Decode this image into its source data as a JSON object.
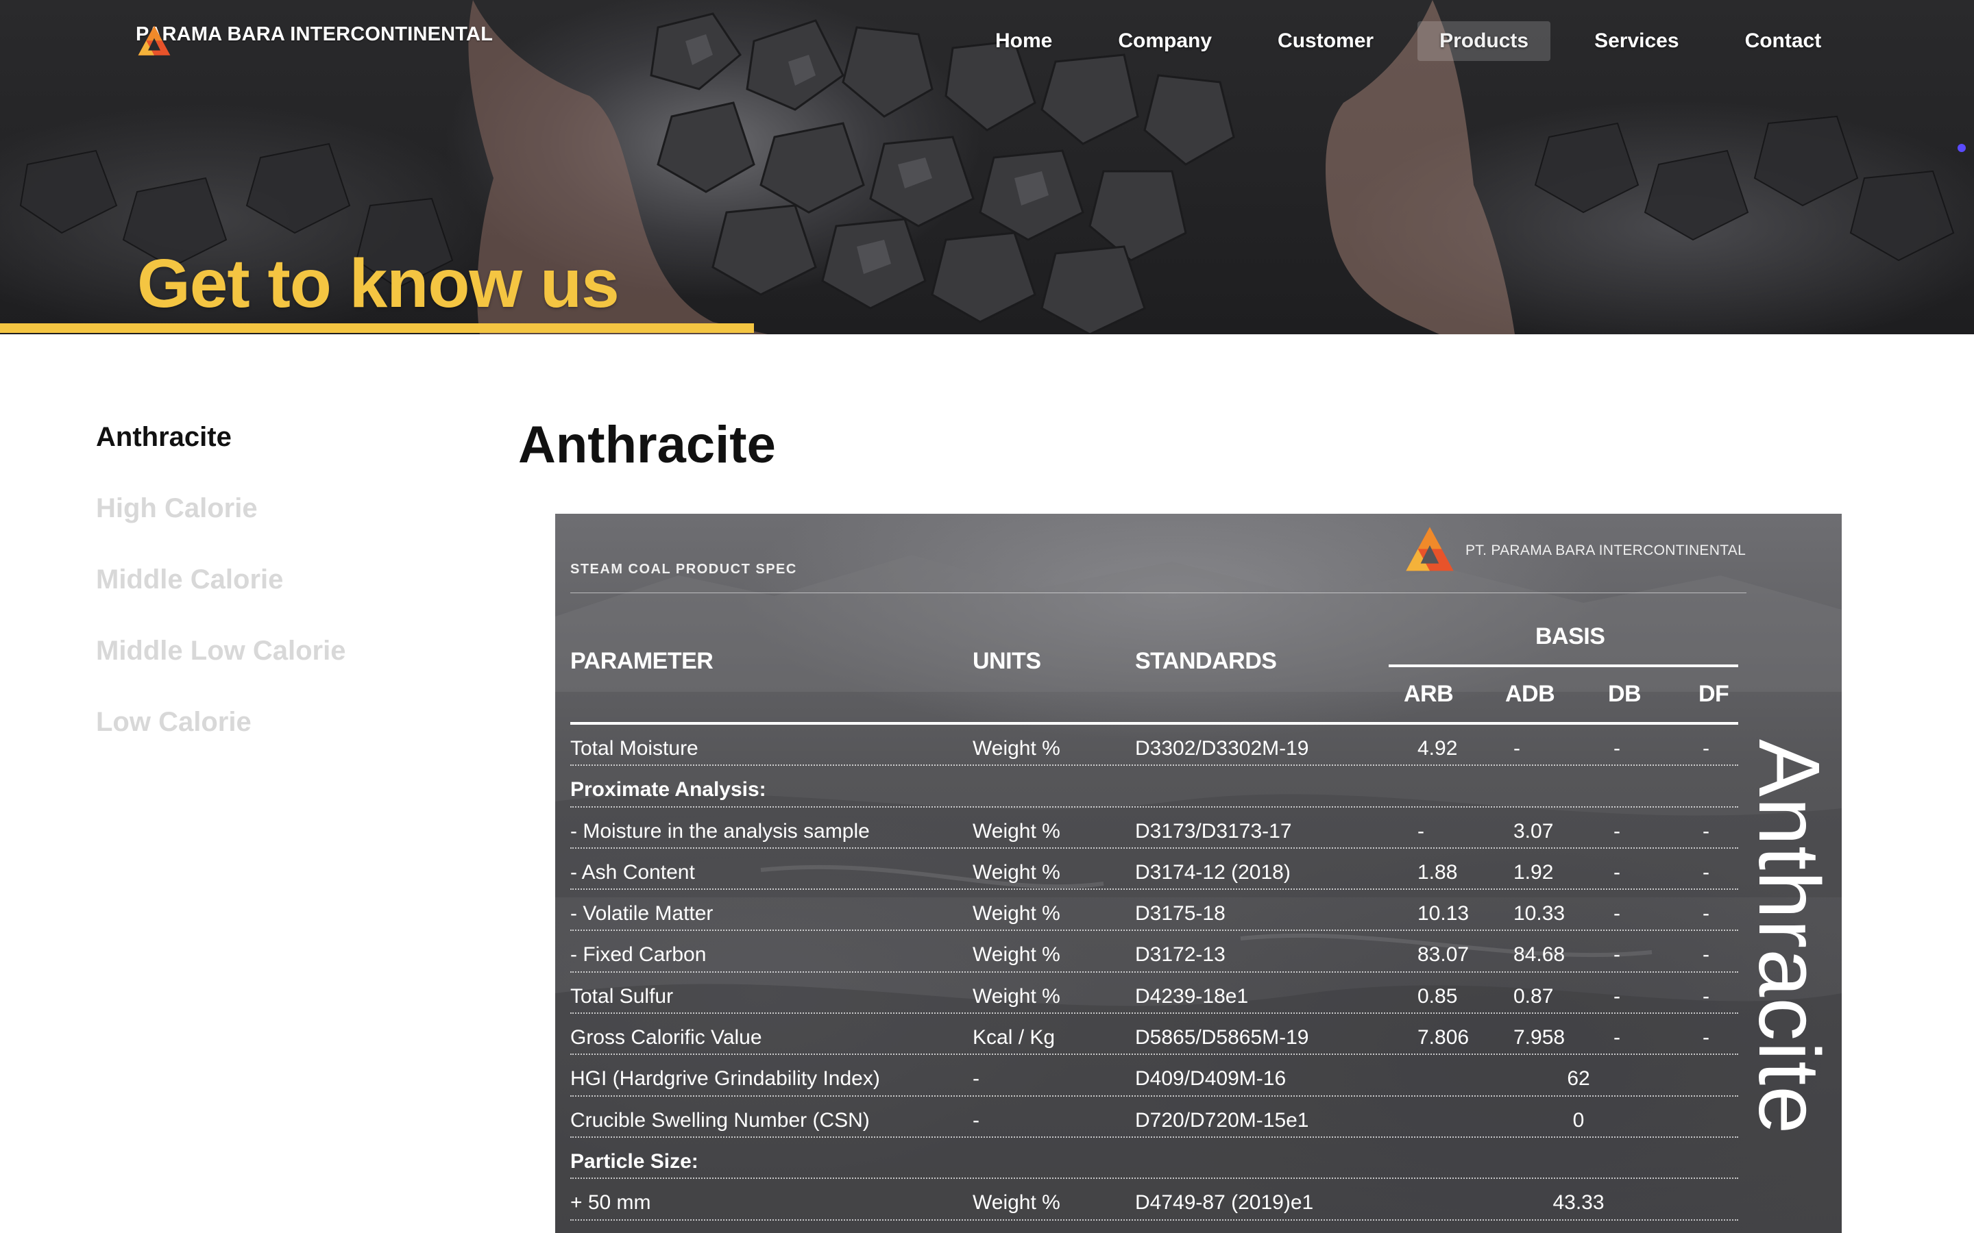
{
  "brand": {
    "name": "PARAMA BARA INTERCONTINENTAL"
  },
  "nav": {
    "items": [
      {
        "label": "Home",
        "active": false
      },
      {
        "label": "Company",
        "active": false
      },
      {
        "label": "Customer",
        "active": false
      },
      {
        "label": "Products",
        "active": true
      },
      {
        "label": "Services",
        "active": false
      },
      {
        "label": "Contact",
        "active": false
      }
    ]
  },
  "hero": {
    "title": "Get to know us",
    "accent_color": "#f4c542"
  },
  "sidebar": {
    "items": [
      {
        "label": "Anthracite",
        "active": true
      },
      {
        "label": "High Calorie",
        "active": false
      },
      {
        "label": "Middle Calorie",
        "active": false
      },
      {
        "label": "Middle Low Calorie",
        "active": false
      },
      {
        "label": "Low Calorie",
        "active": false
      }
    ]
  },
  "main": {
    "title": "Anthracite"
  },
  "spec": {
    "header_label": "STEAM COAL PRODUCT SPEC",
    "company": "PT. PARAMA BARA INTERCONTINENTAL",
    "side_title": "Anthracite",
    "columns": {
      "parameter": "PARAMETER",
      "units": "UNITS",
      "standards": "STANDARDS",
      "basis": "BASIS",
      "arb": "ARB",
      "adb": "ADB",
      "db": "DB",
      "df": "DF"
    },
    "rows": [
      {
        "parameter": "Total Moisture",
        "units": "Weight %",
        "standard": "D3302/D3302M-19",
        "arb": "4.92",
        "adb": "-",
        "db": "-",
        "df": "-"
      },
      {
        "parameter": "Proximate Analysis:",
        "section": true
      },
      {
        "parameter": "- Moisture in the analysis sample",
        "units": "Weight %",
        "standard": "D3173/D3173-17",
        "arb": "-",
        "adb": "3.07",
        "db": "-",
        "df": "-"
      },
      {
        "parameter": "- Ash Content",
        "units": "Weight %",
        "standard": "D3174-12 (2018)",
        "arb": "1.88",
        "adb": "1.92",
        "db": "-",
        "df": "-"
      },
      {
        "parameter": "- Volatile Matter",
        "units": "Weight %",
        "standard": "D3175-18",
        "arb": "10.13",
        "adb": "10.33",
        "db": "-",
        "df": "-"
      },
      {
        "parameter": "- Fixed Carbon",
        "units": "Weight %",
        "standard": "D3172-13",
        "arb": "83.07",
        "adb": "84.68",
        "db": "-",
        "df": "-"
      },
      {
        "parameter": "Total Sulfur",
        "units": "Weight %",
        "standard": "D4239-18e1",
        "arb": "0.85",
        "adb": "0.87",
        "db": "-",
        "df": "-"
      },
      {
        "parameter": "Gross Calorific Value",
        "units": "Kcal / Kg",
        "standard": "D5865/D5865M-19",
        "arb": "7.806",
        "adb": "7.958",
        "db": "-",
        "df": "-"
      },
      {
        "parameter": "HGI (Hardgrive Grindability Index)",
        "units": "-",
        "standard": "D409/D409M-16",
        "merged": "62"
      },
      {
        "parameter": "Crucible Swelling Number (CSN)",
        "units": "-",
        "standard": "D720/D720M-15e1",
        "merged": "0"
      },
      {
        "parameter": "Particle Size:",
        "section": true
      },
      {
        "parameter": "+ 50 mm",
        "units": "Weight %",
        "standard": "D4749-87 (2019)e1",
        "merged": "43.33"
      }
    ]
  }
}
